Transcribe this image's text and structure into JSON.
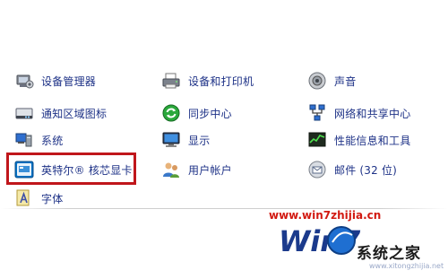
{
  "control_panel": {
    "items": [
      {
        "label": "设备管理器",
        "icon": "device-manager-icon"
      },
      {
        "label": "设备和打印机",
        "icon": "printer-icon"
      },
      {
        "label": "声音",
        "icon": "speaker-icon"
      },
      {
        "label": "通知区域图标",
        "icon": "notification-area-icon"
      },
      {
        "label": "同步中心",
        "icon": "sync-center-icon"
      },
      {
        "label": "网络和共享中心",
        "icon": "network-icon"
      },
      {
        "label": "系统",
        "icon": "system-icon"
      },
      {
        "label": "显示",
        "icon": "display-icon"
      },
      {
        "label": "性能信息和工具",
        "icon": "performance-icon"
      },
      {
        "label": "英特尔® 核芯显卡",
        "icon": "intel-graphics-icon"
      },
      {
        "label": "用户帐户",
        "icon": "user-accounts-icon"
      },
      {
        "label": "邮件 (32 位)",
        "icon": "mail-icon"
      },
      {
        "label": "字体",
        "icon": "fonts-icon"
      }
    ],
    "highlight_color": "#c0161b"
  },
  "watermark": {
    "url": "www.win7zhijia.cn",
    "logo_text": "Win7",
    "site_name": "系统之家",
    "site_url": "www.xitongzhijia.net"
  }
}
